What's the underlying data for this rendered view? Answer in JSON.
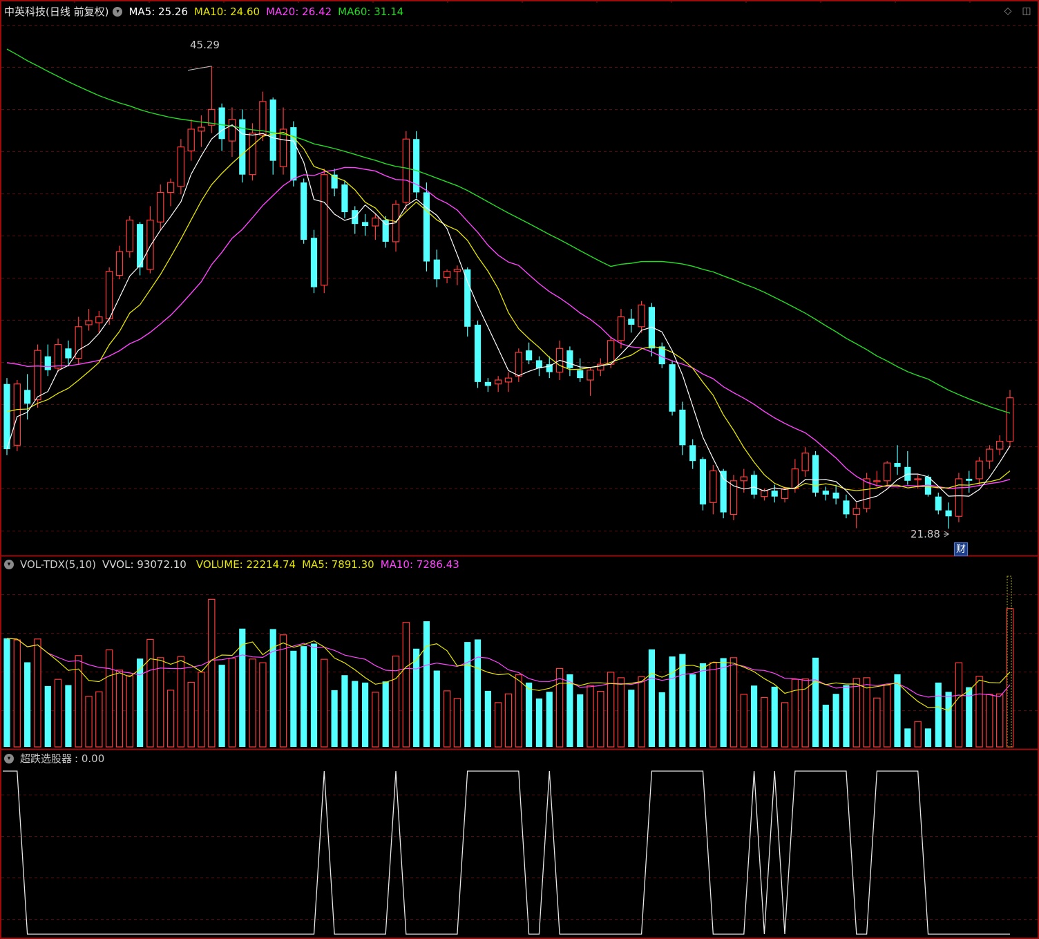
{
  "colors": {
    "bg": "#000000",
    "frame": "#9b0d0d",
    "grid": "#5a0a0a",
    "up": "#ff3b3b",
    "down": "#54ffff",
    "ma5": "#ffffff",
    "ma10": "#e6e600",
    "ma20": "#ff44ff",
    "ma60": "#22dd22",
    "label": "#c8c8c8"
  },
  "price_panel": {
    "title": "中英科技(日线 前复权)",
    "indicators": [
      {
        "label": "MA5: 25.26",
        "color": "#ffffff"
      },
      {
        "label": "MA10: 24.60",
        "color": "#e6e600"
      },
      {
        "label": "MA20: 26.42",
        "color": "#ff44ff"
      },
      {
        "label": "MA60: 31.14",
        "color": "#22dd22"
      }
    ],
    "high_label": "45.29",
    "low_label": "21.88",
    "event_badge": "财"
  },
  "volume_panel": {
    "title": "VOL-TDX(5,10)",
    "indicators": [
      {
        "label": "VVOL: 93072.10",
        "color": "#d8d8d8"
      },
      {
        "label": "VOLUME: 22214.74",
        "color": "#e6e600"
      },
      {
        "label": "MA5: 7891.30",
        "color": "#e6e600"
      },
      {
        "label": "MA10: 7286.43",
        "color": "#ff44ff"
      }
    ]
  },
  "signal_panel": {
    "title": "超跌选股器",
    "value": ": 0.00"
  },
  "window_buttons": {
    "restore": "◇",
    "maximize": "◫"
  },
  "chart_data": {
    "type": "candlestick",
    "price_range": [
      21.88,
      45.29
    ],
    "ohlc": [
      [
        29.2,
        29.5,
        25.6,
        25.9
      ],
      [
        26.1,
        29.4,
        25.8,
        29.2
      ],
      [
        28.9,
        29.7,
        27.4,
        28.2
      ],
      [
        28.4,
        31.2,
        28.0,
        30.9
      ],
      [
        30.6,
        31.2,
        29.6,
        29.9
      ],
      [
        30.0,
        31.5,
        29.8,
        31.2
      ],
      [
        31.0,
        31.4,
        30.2,
        30.5
      ],
      [
        30.5,
        32.6,
        30.2,
        32.1
      ],
      [
        32.2,
        33.0,
        31.9,
        32.4
      ],
      [
        32.3,
        32.9,
        31.8,
        32.6
      ],
      [
        32.5,
        35.1,
        32.2,
        34.9
      ],
      [
        34.7,
        36.2,
        34.5,
        35.9
      ],
      [
        35.9,
        37.7,
        35.6,
        37.5
      ],
      [
        37.3,
        37.4,
        34.7,
        35.1
      ],
      [
        35.0,
        38.2,
        34.8,
        37.5
      ],
      [
        37.4,
        39.3,
        37.0,
        38.9
      ],
      [
        38.9,
        39.6,
        38.2,
        39.4
      ],
      [
        39.2,
        41.6,
        38.8,
        41.2
      ],
      [
        41.0,
        42.6,
        40.5,
        42.1
      ],
      [
        42.0,
        42.8,
        41.2,
        42.2
      ],
      [
        42.3,
        45.29,
        41.9,
        43.1
      ],
      [
        43.2,
        43.4,
        41.0,
        41.6
      ],
      [
        41.5,
        43.2,
        40.7,
        42.6
      ],
      [
        42.6,
        43.1,
        39.4,
        39.8
      ],
      [
        39.8,
        42.4,
        39.5,
        41.9
      ],
      [
        41.8,
        44.0,
        41.5,
        43.5
      ],
      [
        43.6,
        43.7,
        39.8,
        40.5
      ],
      [
        40.2,
        43.2,
        39.8,
        42.1
      ],
      [
        42.2,
        42.5,
        39.2,
        39.5
      ],
      [
        39.4,
        39.6,
        36.3,
        36.5
      ],
      [
        36.6,
        37.0,
        33.8,
        34.1
      ],
      [
        34.2,
        40.1,
        33.8,
        39.8
      ],
      [
        39.8,
        40.1,
        38.7,
        39.1
      ],
      [
        39.3,
        39.5,
        37.6,
        37.9
      ],
      [
        38.0,
        38.2,
        36.8,
        37.3
      ],
      [
        37.4,
        37.8,
        36.7,
        37.2
      ],
      [
        37.2,
        37.8,
        36.5,
        37.6
      ],
      [
        37.5,
        37.7,
        36.1,
        36.4
      ],
      [
        36.4,
        38.5,
        35.9,
        38.3
      ],
      [
        38.4,
        42.0,
        38.0,
        41.6
      ],
      [
        41.6,
        42.0,
        38.6,
        38.9
      ],
      [
        38.9,
        39.4,
        34.9,
        35.4
      ],
      [
        35.5,
        36.0,
        34.1,
        34.5
      ],
      [
        34.6,
        35.0,
        34.3,
        34.9
      ],
      [
        34.9,
        35.2,
        34.2,
        35.0
      ],
      [
        35.0,
        35.1,
        31.6,
        32.1
      ],
      [
        32.2,
        32.4,
        29.0,
        29.3
      ],
      [
        29.3,
        29.5,
        28.8,
        29.1
      ],
      [
        29.2,
        29.6,
        28.8,
        29.4
      ],
      [
        29.3,
        29.8,
        28.8,
        29.5
      ],
      [
        29.6,
        31.0,
        29.3,
        30.8
      ],
      [
        30.9,
        31.3,
        30.2,
        30.4
      ],
      [
        30.4,
        30.6,
        29.6,
        30.0
      ],
      [
        30.2,
        30.6,
        29.5,
        29.8
      ],
      [
        29.8,
        31.4,
        29.4,
        31.0
      ],
      [
        30.9,
        31.1,
        29.6,
        30.0
      ],
      [
        29.9,
        30.5,
        29.3,
        29.5
      ],
      [
        29.4,
        30.0,
        28.6,
        29.9
      ],
      [
        29.9,
        30.5,
        29.6,
        30.2
      ],
      [
        30.2,
        31.6,
        30.0,
        31.4
      ],
      [
        31.4,
        33.0,
        31.0,
        32.6
      ],
      [
        32.5,
        33.0,
        31.8,
        32.2
      ],
      [
        32.1,
        33.4,
        31.8,
        33.2
      ],
      [
        33.1,
        33.3,
        30.6,
        31.0
      ],
      [
        31.1,
        31.3,
        30.0,
        30.2
      ],
      [
        30.2,
        30.4,
        27.6,
        27.8
      ],
      [
        27.9,
        28.3,
        25.6,
        26.1
      ],
      [
        26.1,
        26.4,
        24.9,
        25.3
      ],
      [
        25.4,
        25.5,
        22.8,
        23.1
      ],
      [
        23.2,
        25.1,
        22.6,
        24.8
      ],
      [
        24.8,
        24.9,
        22.4,
        22.7
      ],
      [
        22.6,
        24.6,
        22.3,
        24.3
      ],
      [
        24.3,
        24.9,
        23.7,
        24.5
      ],
      [
        24.6,
        24.8,
        23.4,
        23.6
      ],
      [
        23.5,
        23.9,
        23.3,
        23.8
      ],
      [
        23.8,
        24.1,
        23.2,
        23.5
      ],
      [
        23.4,
        24.0,
        23.2,
        23.9
      ],
      [
        23.9,
        25.4,
        23.7,
        24.9
      ],
      [
        24.8,
        26.0,
        24.5,
        25.7
      ],
      [
        25.6,
        25.8,
        23.5,
        23.7
      ],
      [
        23.8,
        24.0,
        23.3,
        23.6
      ],
      [
        23.7,
        24.1,
        23.1,
        23.4
      ],
      [
        23.3,
        23.6,
        22.4,
        22.6
      ],
      [
        22.6,
        23.2,
        21.9,
        22.9
      ],
      [
        22.9,
        24.7,
        22.7,
        24.4
      ],
      [
        24.3,
        24.8,
        24.0,
        24.3
      ],
      [
        24.3,
        25.3,
        24.1,
        25.2
      ],
      [
        25.2,
        26.1,
        24.6,
        25.0
      ],
      [
        25.0,
        25.8,
        24.1,
        24.3
      ],
      [
        24.4,
        24.6,
        23.9,
        24.4
      ],
      [
        24.5,
        24.6,
        23.5,
        23.6
      ],
      [
        23.5,
        23.7,
        22.6,
        22.8
      ],
      [
        22.8,
        23.2,
        21.88,
        22.5
      ],
      [
        22.5,
        24.7,
        22.2,
        24.4
      ],
      [
        24.4,
        24.8,
        23.7,
        24.3
      ],
      [
        24.4,
        25.5,
        24.1,
        25.3
      ],
      [
        25.3,
        26.1,
        24.9,
        25.9
      ],
      [
        25.9,
        26.6,
        25.6,
        26.3
      ],
      [
        26.3,
        28.9,
        26.0,
        28.5
      ]
    ]
  }
}
